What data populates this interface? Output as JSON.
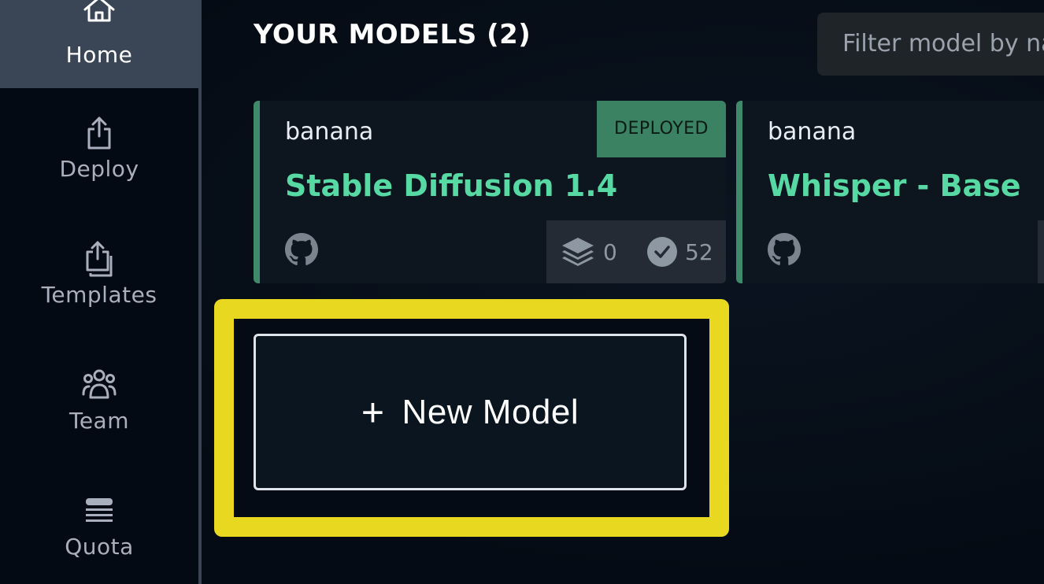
{
  "sidebar": {
    "items": [
      {
        "label": "Home",
        "icon": "home-icon",
        "active": true
      },
      {
        "label": "Deploy",
        "icon": "share-icon"
      },
      {
        "label": "Templates",
        "icon": "templates-icon"
      },
      {
        "label": "Team",
        "icon": "team-icon"
      },
      {
        "label": "Quota",
        "icon": "quota-icon"
      }
    ]
  },
  "main": {
    "title": "YOUR MODELS (2)",
    "filter_placeholder": "Filter model by name",
    "models": [
      {
        "owner": "banana",
        "name": "Stable Diffusion 1.4",
        "status": "DEPLOYED",
        "layers": "0",
        "calls": "52"
      },
      {
        "owner": "banana",
        "name": "Whisper - Base"
      }
    ],
    "new_model_label": "New Model",
    "new_model_icon": "plus-icon"
  },
  "colors": {
    "accent_green": "#57d9a3",
    "badge_green": "#3b8263",
    "highlight_yellow": "#e8d920",
    "sidebar_active": "#3a4556"
  }
}
